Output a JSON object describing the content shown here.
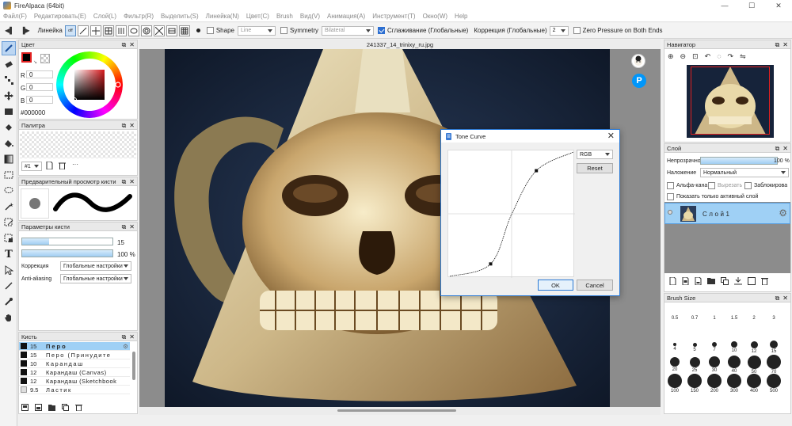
{
  "window": {
    "title": "FireAlpaca (64bit)",
    "controls": [
      "—",
      "☐",
      "✕"
    ]
  },
  "menu": [
    "Файл(F)",
    "Редактировать(E)",
    "Слой(L)",
    "Фильтр(R)",
    "Выделить(S)",
    "Линейка(N)",
    "Цвет(C)",
    "Brush",
    "Вид(V)",
    "Анимация(A)",
    "Инструмент(T)",
    "Окно(W)",
    "Help"
  ],
  "toolbar": {
    "ruler_label": "Линейка",
    "shape_label": "Shape",
    "shape_value": "Line",
    "symmetry_label": "Symmetry",
    "symmetry_value": "Bilateral",
    "smoothing_label": "Сглаживание (Глобальные)",
    "correction_label": "Коррекция (Глобальные)",
    "correction_value": "2",
    "zero_pressure_label": "Zero Pressure on Both Ends"
  },
  "color_panel": {
    "title": "Цвет",
    "r_label": "R",
    "g_label": "G",
    "b_label": "B",
    "r": "0",
    "g": "0",
    "b": "0",
    "hex": "#000000",
    "primary_color": "#000000"
  },
  "palette_panel": {
    "title": "Палитра",
    "selector": "#1"
  },
  "brush_preview_panel": {
    "title": "Предварительный просмотр кисти"
  },
  "brush_params_panel": {
    "title": "Параметры кисти",
    "size_value": "15",
    "size_fraction": 0.3,
    "opacity_value": "100 %",
    "opacity_fraction": 1.0,
    "correction_label": "Коррекция",
    "correction_value": "Глобальные настройки",
    "antialias_label": "Anti-aliasing",
    "antialias_value": "Глобальные настройки"
  },
  "brush_panel": {
    "title": "Кисть",
    "items": [
      {
        "size": "15",
        "name": "Перо",
        "selected": true
      },
      {
        "size": "15",
        "name": "Перо (Принудите",
        "selected": false
      },
      {
        "size": "10",
        "name": "Карандаш",
        "selected": false
      },
      {
        "size": "12",
        "name": "Карандаш (Canvas)",
        "selected": false
      },
      {
        "size": "12",
        "name": "Карандаш (Sketchbook",
        "selected": false
      },
      {
        "size": "9.5",
        "name": "Ластик",
        "selected": false
      }
    ]
  },
  "canvas": {
    "doc_tab": "241337_14_trinixy_ru.jpg"
  },
  "tone_curve": {
    "title": "Tone Curve",
    "channel": "RGB",
    "reset_label": "Reset",
    "ok_label": "OK",
    "cancel_label": "Cancel",
    "points": [
      [
        0,
        0
      ],
      [
        0.33,
        0.1
      ],
      [
        0.5,
        0.5
      ],
      [
        0.7,
        0.85
      ],
      [
        1,
        1
      ]
    ]
  },
  "navigator_panel": {
    "title": "Навигатор"
  },
  "layer_panel": {
    "title": "Слой",
    "opacity_label": "Непрозрачность",
    "opacity_value": "100 %",
    "blend_label": "Наложение",
    "blend_value": "Нормальный",
    "alpha_lock": "Альфа-кана",
    "clipping": "Вырезать",
    "lock": "Заблокирова",
    "show_active_only": "Показать только активный слой",
    "layer_name": "Слой1"
  },
  "brush_size_panel": {
    "title": "Brush Size",
    "sizes": [
      "0.5",
      "0.7",
      "1",
      "1.5",
      "2",
      "3",
      "4",
      "5",
      "7",
      "10",
      "12",
      "15",
      "20",
      "25",
      "30",
      "40",
      "50",
      "70",
      "100",
      "150",
      "200",
      "300",
      "400",
      "500"
    ]
  }
}
